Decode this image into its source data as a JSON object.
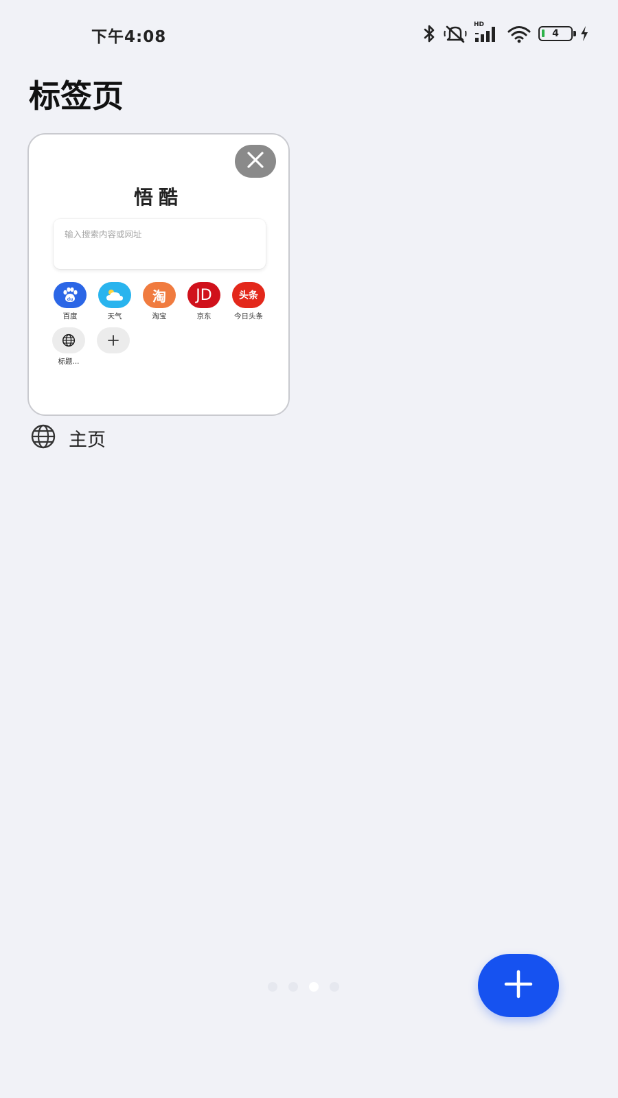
{
  "status_bar": {
    "time": "下午4:08",
    "signal_label": "HD",
    "battery_level": "4",
    "icons": [
      "bluetooth-icon",
      "mute-icon",
      "signal-icon",
      "wifi-icon",
      "battery-icon",
      "charging-icon"
    ]
  },
  "page": {
    "title": "标签页"
  },
  "tab_card": {
    "brand": "悟酷",
    "search_placeholder": "输入搜索内容或网址",
    "shortcuts": [
      {
        "label": "百度",
        "icon": "baidu-icon",
        "color": "#2b66e6"
      },
      {
        "label": "天气",
        "icon": "weather-icon",
        "color": "#29b4ee"
      },
      {
        "label": "淘宝",
        "icon": "taobao-icon",
        "text": "淘",
        "color": "#f07b3f"
      },
      {
        "label": "京东",
        "icon": "jd-icon",
        "text": "JD",
        "color": "#d0111b"
      },
      {
        "label": "今日头条",
        "icon": "toutiao-icon",
        "text": "头条",
        "color": "#e3281b"
      },
      {
        "label": "标题...",
        "icon": "globe-icon",
        "color": "#ececec"
      },
      {
        "label": "",
        "icon": "add-shortcut-icon",
        "color": "#ececec"
      }
    ],
    "tab_title": "主页"
  },
  "pagination": {
    "count": 4,
    "active_index": 2
  },
  "colors": {
    "background": "#f1f2f7",
    "accent": "#1652f0"
  }
}
